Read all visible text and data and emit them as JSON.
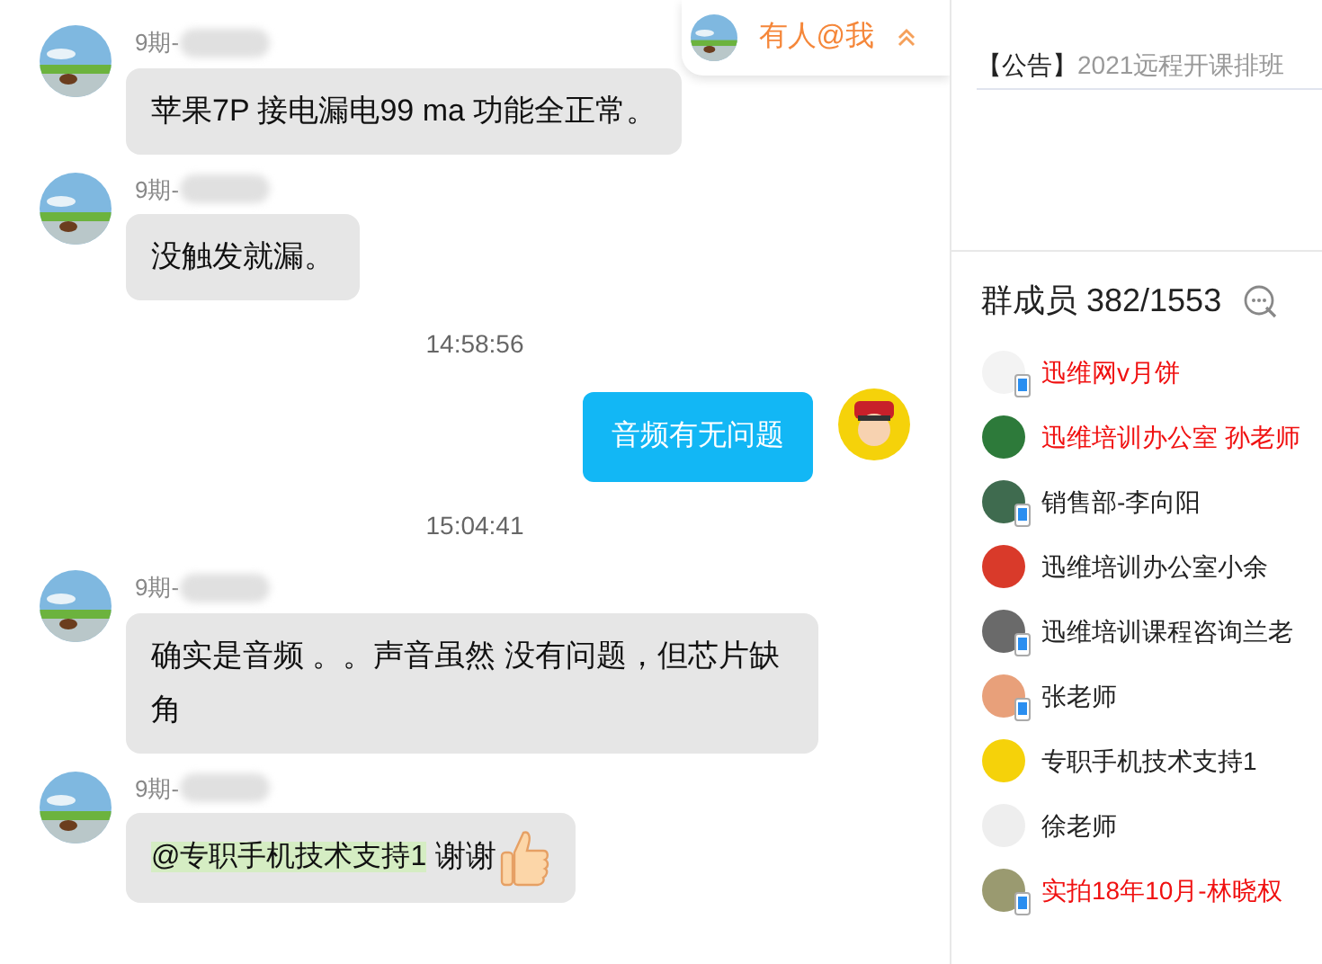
{
  "messages": [
    {
      "kind": "incoming",
      "sender": "9期-",
      "text": "苹果7P 接电漏电99 ma 功能全正常。"
    },
    {
      "kind": "incoming",
      "sender": "9期-",
      "text": "没触发就漏。"
    },
    {
      "kind": "time",
      "text": "14:58:56"
    },
    {
      "kind": "outgoing",
      "text": "音频有无问题"
    },
    {
      "kind": "time",
      "text": "15:04:41"
    },
    {
      "kind": "incoming",
      "sender": "9期-",
      "text": "确实是音频 。。声音虽然 没有问题，但芯片缺角"
    },
    {
      "kind": "incoming",
      "sender": "9期-",
      "mention": "@专职手机技术支持1",
      "text": "谢谢",
      "thumbs_up": true
    }
  ],
  "mention_notice": {
    "label": "有人@我"
  },
  "announcement": {
    "tag": "【公告】",
    "text": "2021远程开课排班"
  },
  "members": {
    "title": "群成员 382/1553",
    "items": [
      {
        "name": "迅维网v月饼",
        "highlighted": true,
        "mobile": true
      },
      {
        "name": "迅维培训办公室 孙老师",
        "highlighted": true,
        "mobile": false
      },
      {
        "name": "销售部-李向阳",
        "highlighted": false,
        "mobile": true
      },
      {
        "name": "迅维培训办公室小余",
        "highlighted": false,
        "mobile": false
      },
      {
        "name": "迅维培训课程咨询兰老",
        "highlighted": false,
        "mobile": true
      },
      {
        "name": "张老师",
        "highlighted": false,
        "mobile": true
      },
      {
        "name": "专职手机技术支持1",
        "highlighted": false,
        "mobile": false
      },
      {
        "name": "徐老师",
        "highlighted": false,
        "mobile": false
      },
      {
        "name": "实拍18年10月-林晓权",
        "highlighted": true,
        "mobile": true
      }
    ]
  }
}
